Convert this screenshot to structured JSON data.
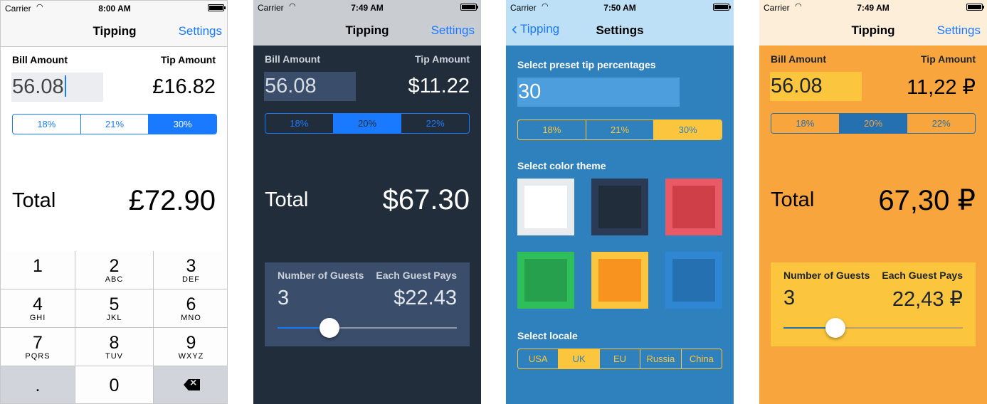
{
  "colors": {
    "ios_blue": "#1a7aff",
    "dark_bg": "#222d3b",
    "dark_nav": "#c9ccd1",
    "blue_bg": "#2f81bd",
    "blue_nav": "#bde0f6",
    "orange_bg": "#f7a53c",
    "orange_nav": "#fdeed9",
    "yellow": "#fbc53d"
  },
  "screen1": {
    "status": {
      "carrier": "Carrier",
      "time": "8:00 AM"
    },
    "nav": {
      "title": "Tipping",
      "settings": "Settings"
    },
    "bill_label": "Bill Amount",
    "tip_label": "Tip Amount",
    "bill_value": "56.08",
    "tip_value": "£16.82",
    "tip_options": [
      "18%",
      "21%",
      "30%"
    ],
    "selected_tip": "30%",
    "total_label": "Total",
    "total_value": "£72.90",
    "keypad": [
      {
        "digit": "1",
        "letters": ""
      },
      {
        "digit": "2",
        "letters": "ABC"
      },
      {
        "digit": "3",
        "letters": "DEF"
      },
      {
        "digit": "4",
        "letters": "GHI"
      },
      {
        "digit": "5",
        "letters": "JKL"
      },
      {
        "digit": "6",
        "letters": "MNO"
      },
      {
        "digit": "7",
        "letters": "PQRS"
      },
      {
        "digit": "8",
        "letters": "TUV"
      },
      {
        "digit": "9",
        "letters": "WXYZ"
      },
      {
        "digit": ".",
        "letters": ""
      },
      {
        "digit": "0",
        "letters": ""
      },
      {
        "digit": "",
        "letters": ""
      }
    ]
  },
  "screen2": {
    "status": {
      "carrier": "Carrier",
      "time": "7:49 AM"
    },
    "nav": {
      "title": "Tipping",
      "settings": "Settings"
    },
    "bill_label": "Bill Amount",
    "tip_label": "Tip Amount",
    "bill_value": "56.08",
    "tip_value": "$11.22",
    "tip_options": [
      "18%",
      "20%",
      "22%"
    ],
    "selected_tip": "20%",
    "total_label": "Total",
    "total_value": "$67.30",
    "guests_label": "Number of Guests",
    "each_label": "Each Guest Pays",
    "guests_value": "3",
    "each_value": "$22.43",
    "slider_fraction": 0.29
  },
  "screen3": {
    "status": {
      "carrier": "Carrier",
      "time": "7:50 AM"
    },
    "nav": {
      "back": "Tipping",
      "title": "Settings"
    },
    "preset_label": "Select preset tip percentages",
    "preset_value": "30",
    "tip_options": [
      "18%",
      "21%",
      "30%"
    ],
    "selected_tip": "30%",
    "theme_label": "Select color theme",
    "themes": [
      {
        "name": "white",
        "outer": "#e8ecef",
        "inner": "#ffffff"
      },
      {
        "name": "dark",
        "outer": "#2b3a55",
        "inner": "#222d3b"
      },
      {
        "name": "red",
        "outer": "#e85a66",
        "inner": "#cf3f48"
      },
      {
        "name": "green",
        "outer": "#2fbf5a",
        "inner": "#26a04d"
      },
      {
        "name": "orange",
        "outer": "#fbc53d",
        "inner": "#f7931e"
      },
      {
        "name": "blue",
        "outer": "#2f86d2",
        "inner": "#2570b0"
      }
    ],
    "locale_label": "Select locale",
    "locales": [
      "USA",
      "UK",
      "EU",
      "Russia",
      "China"
    ],
    "selected_locale": "UK"
  },
  "screen4": {
    "status": {
      "carrier": "Carrier",
      "time": "7:49 AM"
    },
    "nav": {
      "title": "Tipping",
      "settings": "Settings"
    },
    "bill_label": "Bill Amount",
    "tip_label": "Tip Amount",
    "bill_value": "56.08",
    "tip_value": "11,22 ₽",
    "tip_options": [
      "18%",
      "20%",
      "22%"
    ],
    "selected_tip": "20%",
    "total_label": "Total",
    "total_value": "67,30 ₽",
    "guests_label": "Number of Guests",
    "each_label": "Each Guest Pays",
    "guests_value": "3",
    "each_value": "22,43 ₽",
    "slider_fraction": 0.29
  }
}
